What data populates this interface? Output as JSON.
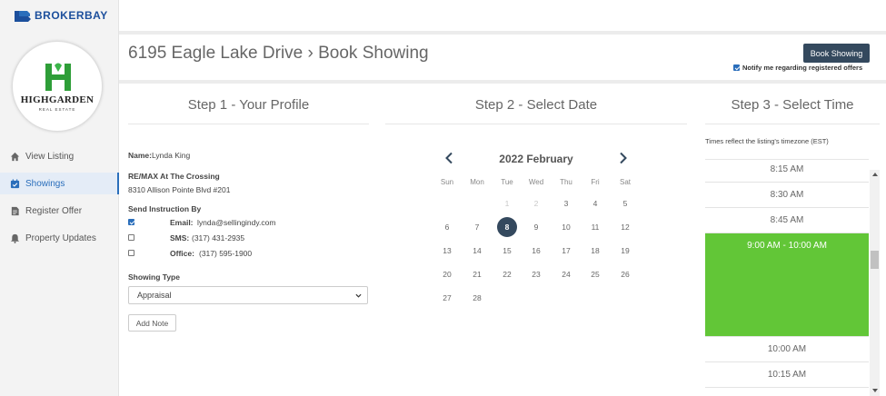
{
  "brand": {
    "name": "BROKERBAY"
  },
  "logo": {
    "name": "HIGHGARDEN",
    "tagline": "REAL ESTATE",
    "color": "#2e9e38"
  },
  "sidebar": {
    "items": [
      {
        "label": "View Listing",
        "icon": "home-icon"
      },
      {
        "label": "Showings",
        "icon": "calendar-check-icon",
        "active": true
      },
      {
        "label": "Register Offer",
        "icon": "document-icon"
      },
      {
        "label": "Property Updates",
        "icon": "bell-icon"
      }
    ]
  },
  "header": {
    "title": "6195 Eagle Lake Drive › Book Showing",
    "book_button": "Book Showing",
    "notify_label": "Notify me regarding registered offers",
    "notify_checked": true
  },
  "steps": {
    "step1": "Step 1 - Your Profile",
    "step2": "Step 2 - Select Date",
    "step3": "Step 3 - Select Time"
  },
  "profile": {
    "name_label": "Name:",
    "name_value": "Lynda King",
    "brokerage": "RE/MAX At The Crossing",
    "address": "8310 Allison Pointe Blvd #201",
    "send_instruction_label": "Send Instruction By",
    "contacts": [
      {
        "label": "Email:",
        "value": "lynda@sellingindy.com",
        "checked": true
      },
      {
        "label": "SMS:",
        "value": "(317) 431-2935",
        "checked": false
      },
      {
        "label": "Office:",
        "value": "(317) 595-1900",
        "checked": false
      }
    ],
    "showing_type_label": "Showing Type",
    "showing_type_value": "Appraisal",
    "add_note": "Add Note"
  },
  "calendar": {
    "month_label": "2022 February",
    "weekdays": [
      "Sun",
      "Mon",
      "Tue",
      "Wed",
      "Thu",
      "Fri",
      "Sat"
    ],
    "weeks": [
      [
        null,
        null,
        "1",
        "2",
        "3",
        "4",
        "5"
      ],
      [
        "6",
        "7",
        "8",
        "9",
        "10",
        "11",
        "12"
      ],
      [
        "13",
        "14",
        "15",
        "16",
        "17",
        "18",
        "19"
      ],
      [
        "20",
        "21",
        "22",
        "23",
        "24",
        "25",
        "26"
      ],
      [
        "27",
        "28",
        null,
        null,
        null,
        null,
        null
      ]
    ],
    "disabled_days": [
      "1",
      "2"
    ],
    "selected_day": "8"
  },
  "time": {
    "timezone_note": "Times reflect the listing's timezone (EST)",
    "slots": [
      "8:15 AM",
      "8:30 AM",
      "8:45 AM",
      "9:00 AM - 10:00 AM",
      "10:00 AM",
      "10:15 AM"
    ],
    "selected_slot": "9:00 AM - 10:00 AM",
    "selected_color": "#62c637"
  }
}
